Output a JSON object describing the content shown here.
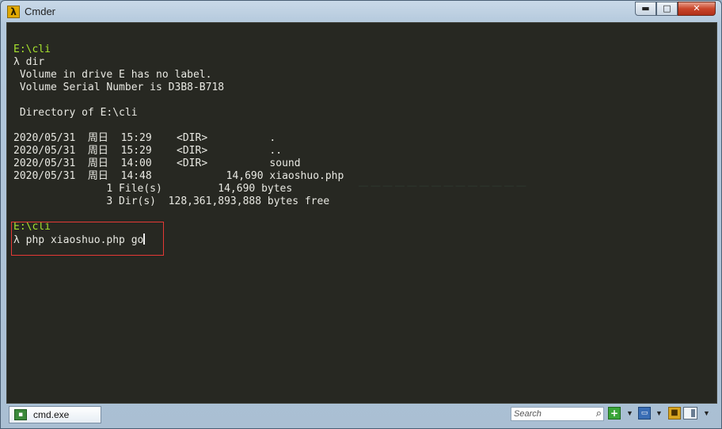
{
  "window": {
    "title": "Cmder",
    "app_icon": "λ"
  },
  "controls": {
    "minimize": "▬",
    "maximize": "□",
    "close": "✕"
  },
  "terminal": {
    "lines": [
      {
        "kind": "path",
        "text": "E:\\cli"
      },
      {
        "kind": "cmd",
        "lambda": "λ",
        "text": " dir"
      },
      {
        "kind": "out",
        "text": " Volume in drive E has no label."
      },
      {
        "kind": "out",
        "text": " Volume Serial Number is D3B8-B718"
      },
      {
        "kind": "out",
        "text": ""
      },
      {
        "kind": "out",
        "text": " Directory of E:\\cli"
      },
      {
        "kind": "out",
        "text": ""
      },
      {
        "kind": "out",
        "text": "2020/05/31  周日  15:29    <DIR>          ."
      },
      {
        "kind": "out",
        "text": "2020/05/31  周日  15:29    <DIR>          .."
      },
      {
        "kind": "out",
        "text": "2020/05/31  周日  14:00    <DIR>          sound"
      },
      {
        "kind": "out",
        "text": "2020/05/31  周日  14:48            14,690 xiaoshuo.php"
      },
      {
        "kind": "out",
        "text": "               1 File(s)         14,690 bytes"
      },
      {
        "kind": "out",
        "text": "               3 Dir(s)  128,361,893,888 bytes free"
      },
      {
        "kind": "out",
        "text": ""
      },
      {
        "kind": "path",
        "text": "E:\\cli"
      },
      {
        "kind": "cmd",
        "lambda": "λ",
        "text": " php xiaoshuo.php go",
        "cursor": true
      }
    ]
  },
  "statusbar": {
    "tab_label": "cmd.exe",
    "search_placeholder": "Search",
    "icons": {
      "search": "⌕",
      "add": "+",
      "dropdown": "▼",
      "console": "▭",
      "lock": "🔒",
      "menu": "▼"
    }
  },
  "colors": {
    "terminal_bg": "#272822",
    "prompt_green": "#a6e22e",
    "highlight_red": "#e53935"
  }
}
